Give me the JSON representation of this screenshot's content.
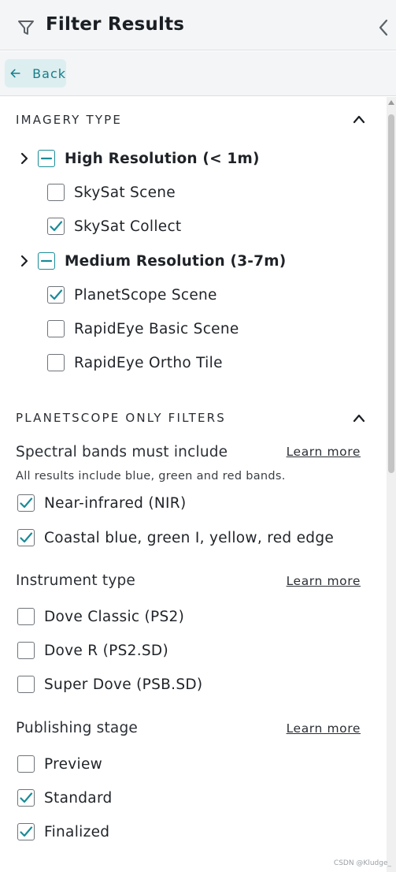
{
  "header": {
    "title": "Filter Results"
  },
  "subbar": {
    "back_label": "Back"
  },
  "imagery": {
    "title": "IMAGERY TYPE",
    "groups": [
      {
        "label": "High Resolution (< 1m)",
        "items": [
          {
            "label": "SkySat Scene",
            "checked": false
          },
          {
            "label": "SkySat Collect",
            "checked": true
          }
        ]
      },
      {
        "label": "Medium Resolution (3-7m)",
        "items": [
          {
            "label": "PlanetScope Scene",
            "checked": true
          },
          {
            "label": "RapidEye Basic Scene",
            "checked": false
          },
          {
            "label": "RapidEye Ortho Tile",
            "checked": false
          }
        ]
      }
    ]
  },
  "planetscope": {
    "title": "PLANETSCOPE ONLY FILTERS",
    "spectral": {
      "title": "Spectral bands must include",
      "learn_more": "Learn more",
      "hint": "All results include blue, green and red bands.",
      "options": [
        {
          "label": "Near-infrared (NIR)",
          "checked": true
        },
        {
          "label": "Coastal blue, green I, yellow, red edge",
          "checked": true
        }
      ]
    },
    "instrument": {
      "title": "Instrument type",
      "learn_more": "Learn more",
      "options": [
        {
          "label": "Dove Classic (PS2)",
          "checked": false
        },
        {
          "label": "Dove R (PS2.SD)",
          "checked": false
        },
        {
          "label": "Super Dove (PSB.SD)",
          "checked": false
        }
      ]
    },
    "publishing": {
      "title": "Publishing stage",
      "learn_more": "Learn more",
      "options": [
        {
          "label": "Preview",
          "checked": false
        },
        {
          "label": "Standard",
          "checked": true
        },
        {
          "label": "Finalized",
          "checked": true
        }
      ]
    }
  },
  "watermark": "CSDN @Kludge_",
  "colors": {
    "accent": "#1a8b97",
    "header_bg": "#f3f5f6",
    "back_bg": "#ddeef0"
  }
}
